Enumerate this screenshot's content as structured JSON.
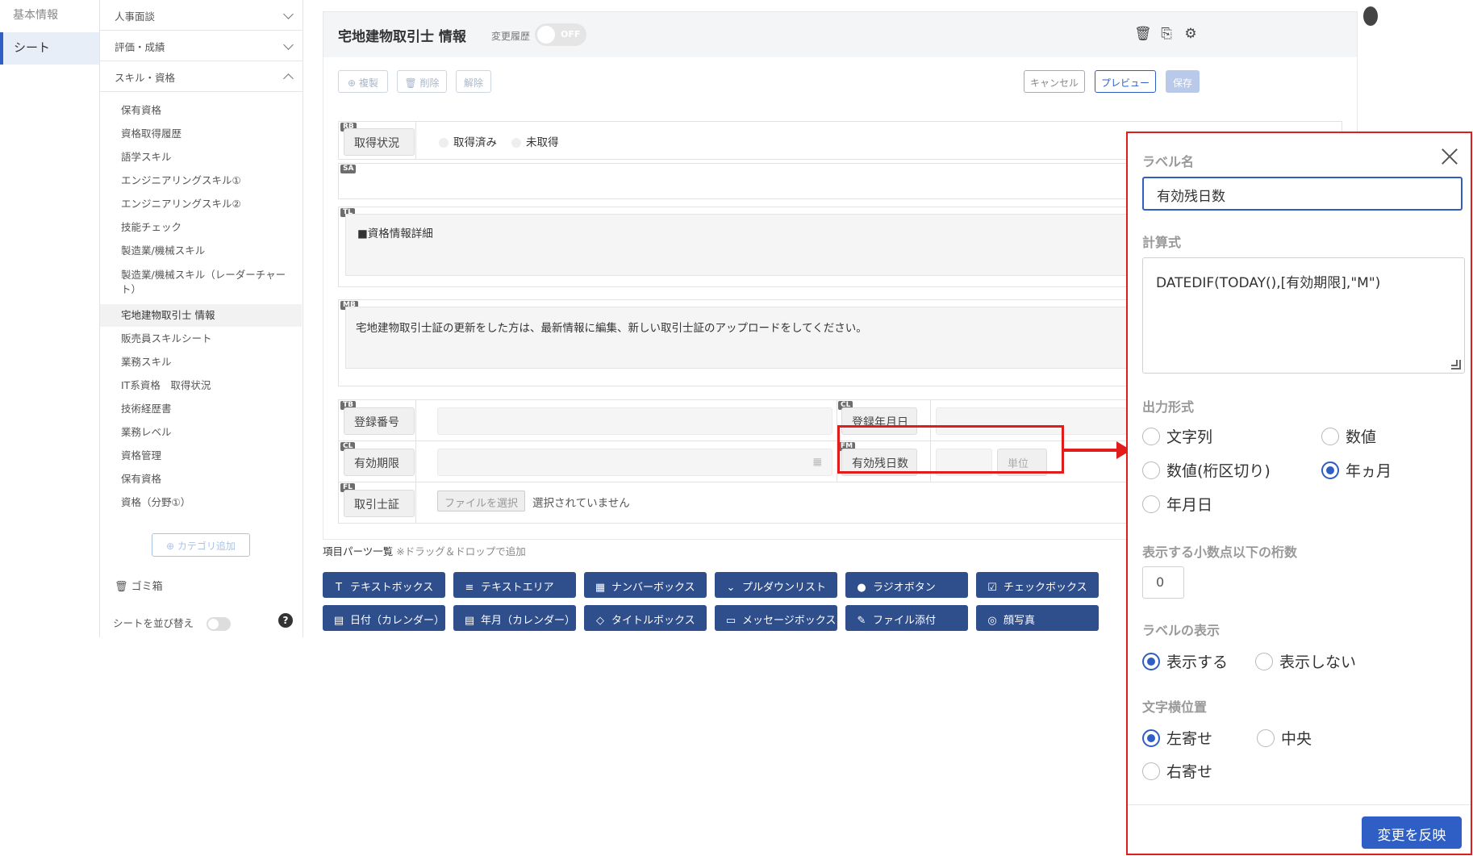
{
  "nav1": {
    "basic": "基本情報",
    "sheet": "シート"
  },
  "categories": [
    {
      "label": "人事面談"
    },
    {
      "label": "評価・成績"
    },
    {
      "label": "スキル・資格"
    }
  ],
  "sheets": [
    "保有資格",
    "資格取得履歴",
    "語学スキル",
    "エンジニアリングスキル①",
    "エンジニアリングスキル②",
    "技能チェック",
    "製造業/機械スキル",
    "製造業/機械スキル（レーダーチャート）",
    "宅地建物取引士 情報",
    "販売員スキルシート",
    "業務スキル",
    "IT系資格　取得状況",
    "技術経歴書",
    "業務レベル",
    "資格管理",
    "保有資格",
    "資格（分野①）"
  ],
  "nav2": {
    "add_category": "カテゴリ追加",
    "trash": "ゴミ箱",
    "sort": "シートを並び替え",
    "help": "?"
  },
  "header": {
    "title": "宅地建物取引士 情報",
    "history": "変更履歴",
    "toggle": "OFF"
  },
  "toolbar": {
    "copy": "複製",
    "delete": "削除",
    "unlink": "解除",
    "cancel": "キャンセル",
    "preview": "プレビュー",
    "save": "保存"
  },
  "form": {
    "status": {
      "tag": "RB",
      "label": "取得状況",
      "opt1": "取得済み",
      "opt2": "未取得"
    },
    "sa": {
      "tag": "SA"
    },
    "tl": {
      "tag": "TL",
      "text": "■資格情報詳細"
    },
    "mb": {
      "tag": "MB",
      "text": "宅地建物取引士証の更新をした方は、最新情報に編集、新しい取引士証のアップロードをしてください。"
    },
    "regno": {
      "tag": "TB",
      "label": "登録番号"
    },
    "regdate": {
      "tag": "CL",
      "label": "登録年月日"
    },
    "expiry": {
      "tag": "CL",
      "label": "有効期限"
    },
    "remain": {
      "tag": "FM",
      "label": "有効残日数",
      "unit": "単位"
    },
    "file": {
      "tag": "FL",
      "label": "取引士証",
      "choose": "ファイルを選択",
      "none": "選択されていません"
    }
  },
  "parts": {
    "title": "項目パーツ一覧",
    "note": "※ドラッグ＆ドロップで追加",
    "row1": [
      "テキストボックス",
      "テキストエリア",
      "ナンバーボックス",
      "プルダウンリスト",
      "ラジオボタン",
      "チェックボックス"
    ],
    "row2": [
      "日付（カレンダー）",
      "年月（カレンダー）",
      "タイトルボックス",
      "メッセージボックス",
      "ファイル添付",
      "顔写真"
    ]
  },
  "panel": {
    "label_name": "ラベル名",
    "label_value": "有効残日数",
    "formula_label": "計算式",
    "formula": "DATEDIF(TODAY(),[有効期限],\"M\")",
    "output_label": "出力形式",
    "output_opts": [
      "文字列",
      "数値",
      "数値(桁区切り)",
      "年ヵ月",
      "年月日"
    ],
    "output_selected": "年ヵ月",
    "decimals_label": "表示する小数点以下の桁数",
    "decimals": "0",
    "display_label": "ラベルの表示",
    "display_opts": [
      "表示する",
      "表示しない"
    ],
    "display_selected": "表示する",
    "align_label": "文字横位置",
    "align_opts": [
      "左寄せ",
      "中央",
      "右寄せ"
    ],
    "align_selected": "左寄せ",
    "apply": "変更を反映"
  },
  "colors": {
    "accent": "#2f5ec4",
    "parts_button": "#2f4e8c",
    "highlight": "#e21b1b"
  }
}
